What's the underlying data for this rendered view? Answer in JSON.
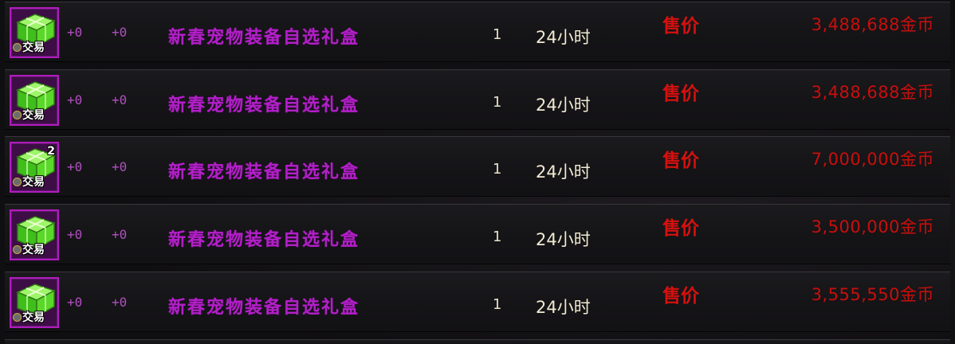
{
  "listings": [
    {
      "stack_count": "",
      "trade_label": "交易",
      "upgrade_1": "+0",
      "upgrade_2": "+0",
      "item_name": "新春宠物装备自选礼盒",
      "quantity": "1",
      "duration": "24小时",
      "price_label": "售价",
      "price": "3,488,688金币"
    },
    {
      "stack_count": "",
      "trade_label": "交易",
      "upgrade_1": "+0",
      "upgrade_2": "+0",
      "item_name": "新春宠物装备自选礼盒",
      "quantity": "1",
      "duration": "24小时",
      "price_label": "售价",
      "price": "3,488,688金币"
    },
    {
      "stack_count": "2",
      "trade_label": "交易",
      "upgrade_1": "+0",
      "upgrade_2": "+0",
      "item_name": "新春宠物装备自选礼盒",
      "quantity": "1",
      "duration": "24小时",
      "price_label": "售价",
      "price": "7,000,000金币"
    },
    {
      "stack_count": "",
      "trade_label": "交易",
      "upgrade_1": "+0",
      "upgrade_2": "+0",
      "item_name": "新春宠物装备自选礼盒",
      "quantity": "1",
      "duration": "24小时",
      "price_label": "售价",
      "price": "3,500,000金币"
    },
    {
      "stack_count": "",
      "trade_label": "交易",
      "upgrade_1": "+0",
      "upgrade_2": "+0",
      "item_name": "新春宠物装备自选礼盒",
      "quantity": "1",
      "duration": "24小时",
      "price_label": "售价",
      "price": "3,555,550金币"
    }
  ],
  "colors": {
    "item_name": "#b21fc8",
    "price": "#c80f0c",
    "icon_border": "#b01cbe",
    "icon_fill": "#5fe02e"
  },
  "icons": {
    "item": "gift-box-icon",
    "trade": "trade-coin-icon"
  }
}
